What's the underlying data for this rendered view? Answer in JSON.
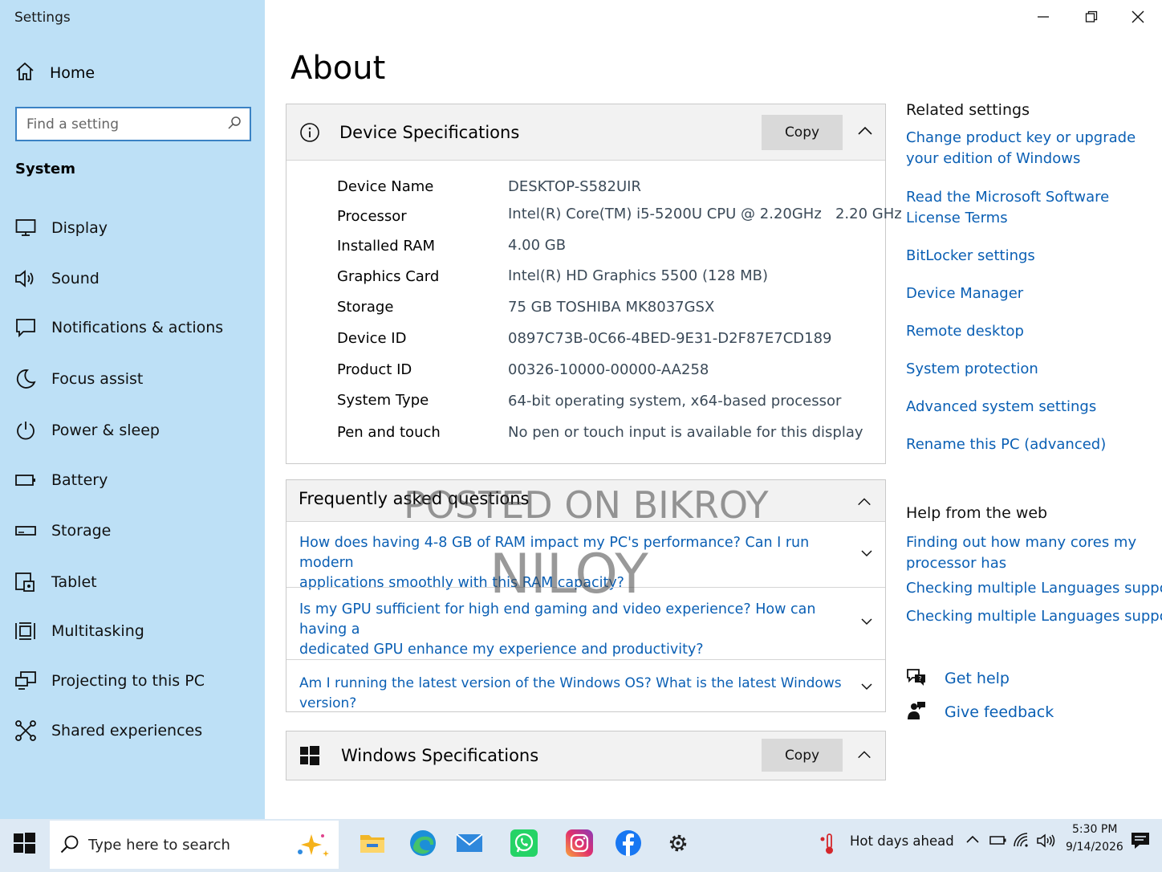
{
  "window": {
    "title": "Settings"
  },
  "sidebar": {
    "home_label": "Home",
    "search_placeholder": "Find a setting",
    "section": "System",
    "items": [
      {
        "label": "Display",
        "icon": "display-icon"
      },
      {
        "label": "Sound",
        "icon": "speaker-icon"
      },
      {
        "label": "Notifications & actions",
        "icon": "notification-icon"
      },
      {
        "label": "Focus assist",
        "icon": "moon-icon"
      },
      {
        "label": "Power & sleep",
        "icon": "power-icon"
      },
      {
        "label": "Battery",
        "icon": "battery-icon"
      },
      {
        "label": "Storage",
        "icon": "storage-icon"
      },
      {
        "label": "Tablet",
        "icon": "tablet-icon"
      },
      {
        "label": "Multitasking",
        "icon": "multitasking-icon"
      },
      {
        "label": "Projecting to this PC",
        "icon": "projecting-icon"
      },
      {
        "label": "Shared experiences",
        "icon": "shared-experiences-icon"
      }
    ]
  },
  "main": {
    "title": "About",
    "device_specs": {
      "title": "Device Specifications",
      "copy_label": "Copy",
      "rows": [
        {
          "label": "Device Name",
          "value": "DESKTOP-S582UIR"
        },
        {
          "label": "Processor",
          "value": "Intel(R) Core(TM) i5-5200U CPU @ 2.20GHz   2.20 GHz"
        },
        {
          "label": "Installed RAM",
          "value": "4.00 GB"
        },
        {
          "label": "Graphics Card",
          "value": "Intel(R) HD Graphics 5500 (128 MB)"
        },
        {
          "label": "Storage",
          "value": "75 GB TOSHIBA MK8037GSX"
        },
        {
          "label": "Device ID",
          "value": "0897C73B-0C66-4BED-9E31-D2F87E7CD189"
        },
        {
          "label": "Product ID",
          "value": "00326-10000-00000-AA258"
        },
        {
          "label": "System Type",
          "value": "64-bit operating system, x64-based processor"
        },
        {
          "label": "Pen and touch",
          "value": "No pen or touch input is available for this display"
        }
      ]
    },
    "faq": {
      "title": "Frequently asked questions",
      "items": [
        {
          "q1": "How does having 4-8 GB of RAM impact my PC's performance? Can I run modern",
          "q2": "applications smoothly with this RAM capacity?"
        },
        {
          "q1": "Is my GPU sufficient for high end gaming and video experience? How can having a",
          "q2": "dedicated GPU enhance my experience and productivity?"
        },
        {
          "q1": "Am I running the latest version of the Windows OS? What is the latest Windows version?",
          "q2": ""
        }
      ]
    },
    "windows_specs": {
      "title": "Windows Specifications",
      "copy_label": "Copy"
    }
  },
  "related": {
    "heading": "Related settings",
    "links": [
      "Change product key or upgrade your edition of Windows",
      "Read the Microsoft Software License Terms",
      "BitLocker settings",
      "Device Manager",
      "Remote desktop",
      "System protection",
      "Advanced system settings",
      "Rename this PC (advanced)"
    ],
    "help_heading": "Help from the web",
    "help_links": [
      "Finding out how many cores my processor has",
      "Checking multiple Languages support",
      "Checking multiple Languages support"
    ],
    "get_help": "Get help",
    "give_feedback": "Give feedback"
  },
  "watermark": {
    "line1": "POSTED ON BIKROY",
    "line2": "NILOY"
  },
  "taskbar": {
    "search_placeholder": "Type here to search",
    "weather": "Hot days ahead",
    "time": "5:30 PM",
    "date": "9/14/2026",
    "apps": [
      "file-explorer-icon",
      "edge-icon",
      "mail-icon",
      "whatsapp-icon",
      "instagram-icon",
      "facebook-icon",
      "settings-gear-icon"
    ]
  },
  "colors": {
    "sidebar_bg": "#bde0f6",
    "link": "#0a5fb4",
    "taskbar_bg": "#dde9f4"
  }
}
